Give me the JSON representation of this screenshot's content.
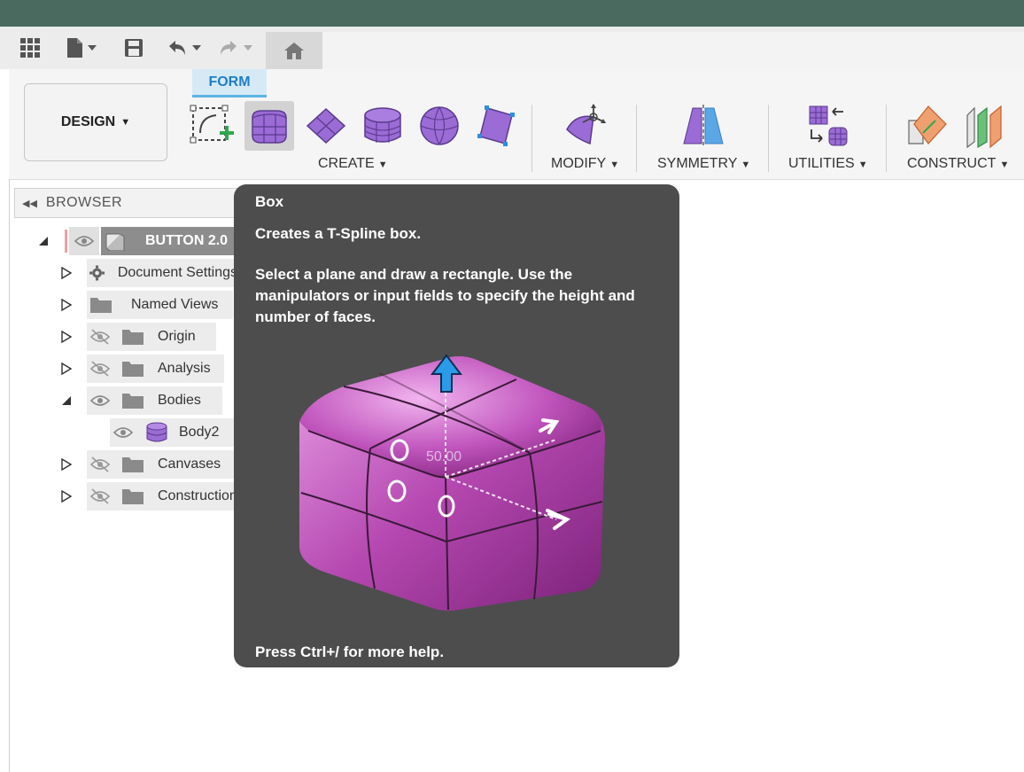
{
  "toolbar": {
    "icons": [
      "grid-icon",
      "file-icon",
      "save-icon",
      "undo-icon",
      "redo-icon",
      "home-icon"
    ]
  },
  "workspace": {
    "label": "DESIGN"
  },
  "tabs": {
    "active": "FORM"
  },
  "ribbon": {
    "groups": {
      "create": "CREATE",
      "modify": "MODIFY",
      "symmetry": "SYMMETRY",
      "utilities": "UTILITIES",
      "construct": "CONSTRUCT"
    },
    "active_tool": "Box"
  },
  "browser": {
    "title": "BROWSER",
    "root": "BUTTON 2.0",
    "items": [
      {
        "label": "Document Settings",
        "icon": "gear-icon"
      },
      {
        "label": "Named Views",
        "icon": "folder-icon"
      },
      {
        "label": "Origin",
        "icon": "folder-icon",
        "visible": false
      },
      {
        "label": "Analysis",
        "icon": "folder-icon",
        "visible": false
      },
      {
        "label": "Bodies",
        "icon": "folder-icon",
        "visible": true,
        "expanded": true
      },
      {
        "label": "Body2",
        "icon": "body-icon",
        "visible": true
      },
      {
        "label": "Canvases",
        "icon": "folder-icon",
        "visible": false
      },
      {
        "label": "Construction",
        "icon": "folder-icon",
        "visible": false
      }
    ]
  },
  "tooltip": {
    "title": "Box",
    "line1": "Creates a T-Spline box.",
    "body": "Select a plane and draw a rectangle. Use the manipulators or input fields to specify the height and number of faces.",
    "dimension": "50.00",
    "footer": "Press Ctrl+/ for more help."
  },
  "colors": {
    "accent": "#1e7fc4",
    "form_tab_bg": "#d6eaf5",
    "title_bar": "#4a6a5f",
    "tool_purple": "#9b6bd6",
    "tooltip_bg": "#4d4d4d"
  }
}
